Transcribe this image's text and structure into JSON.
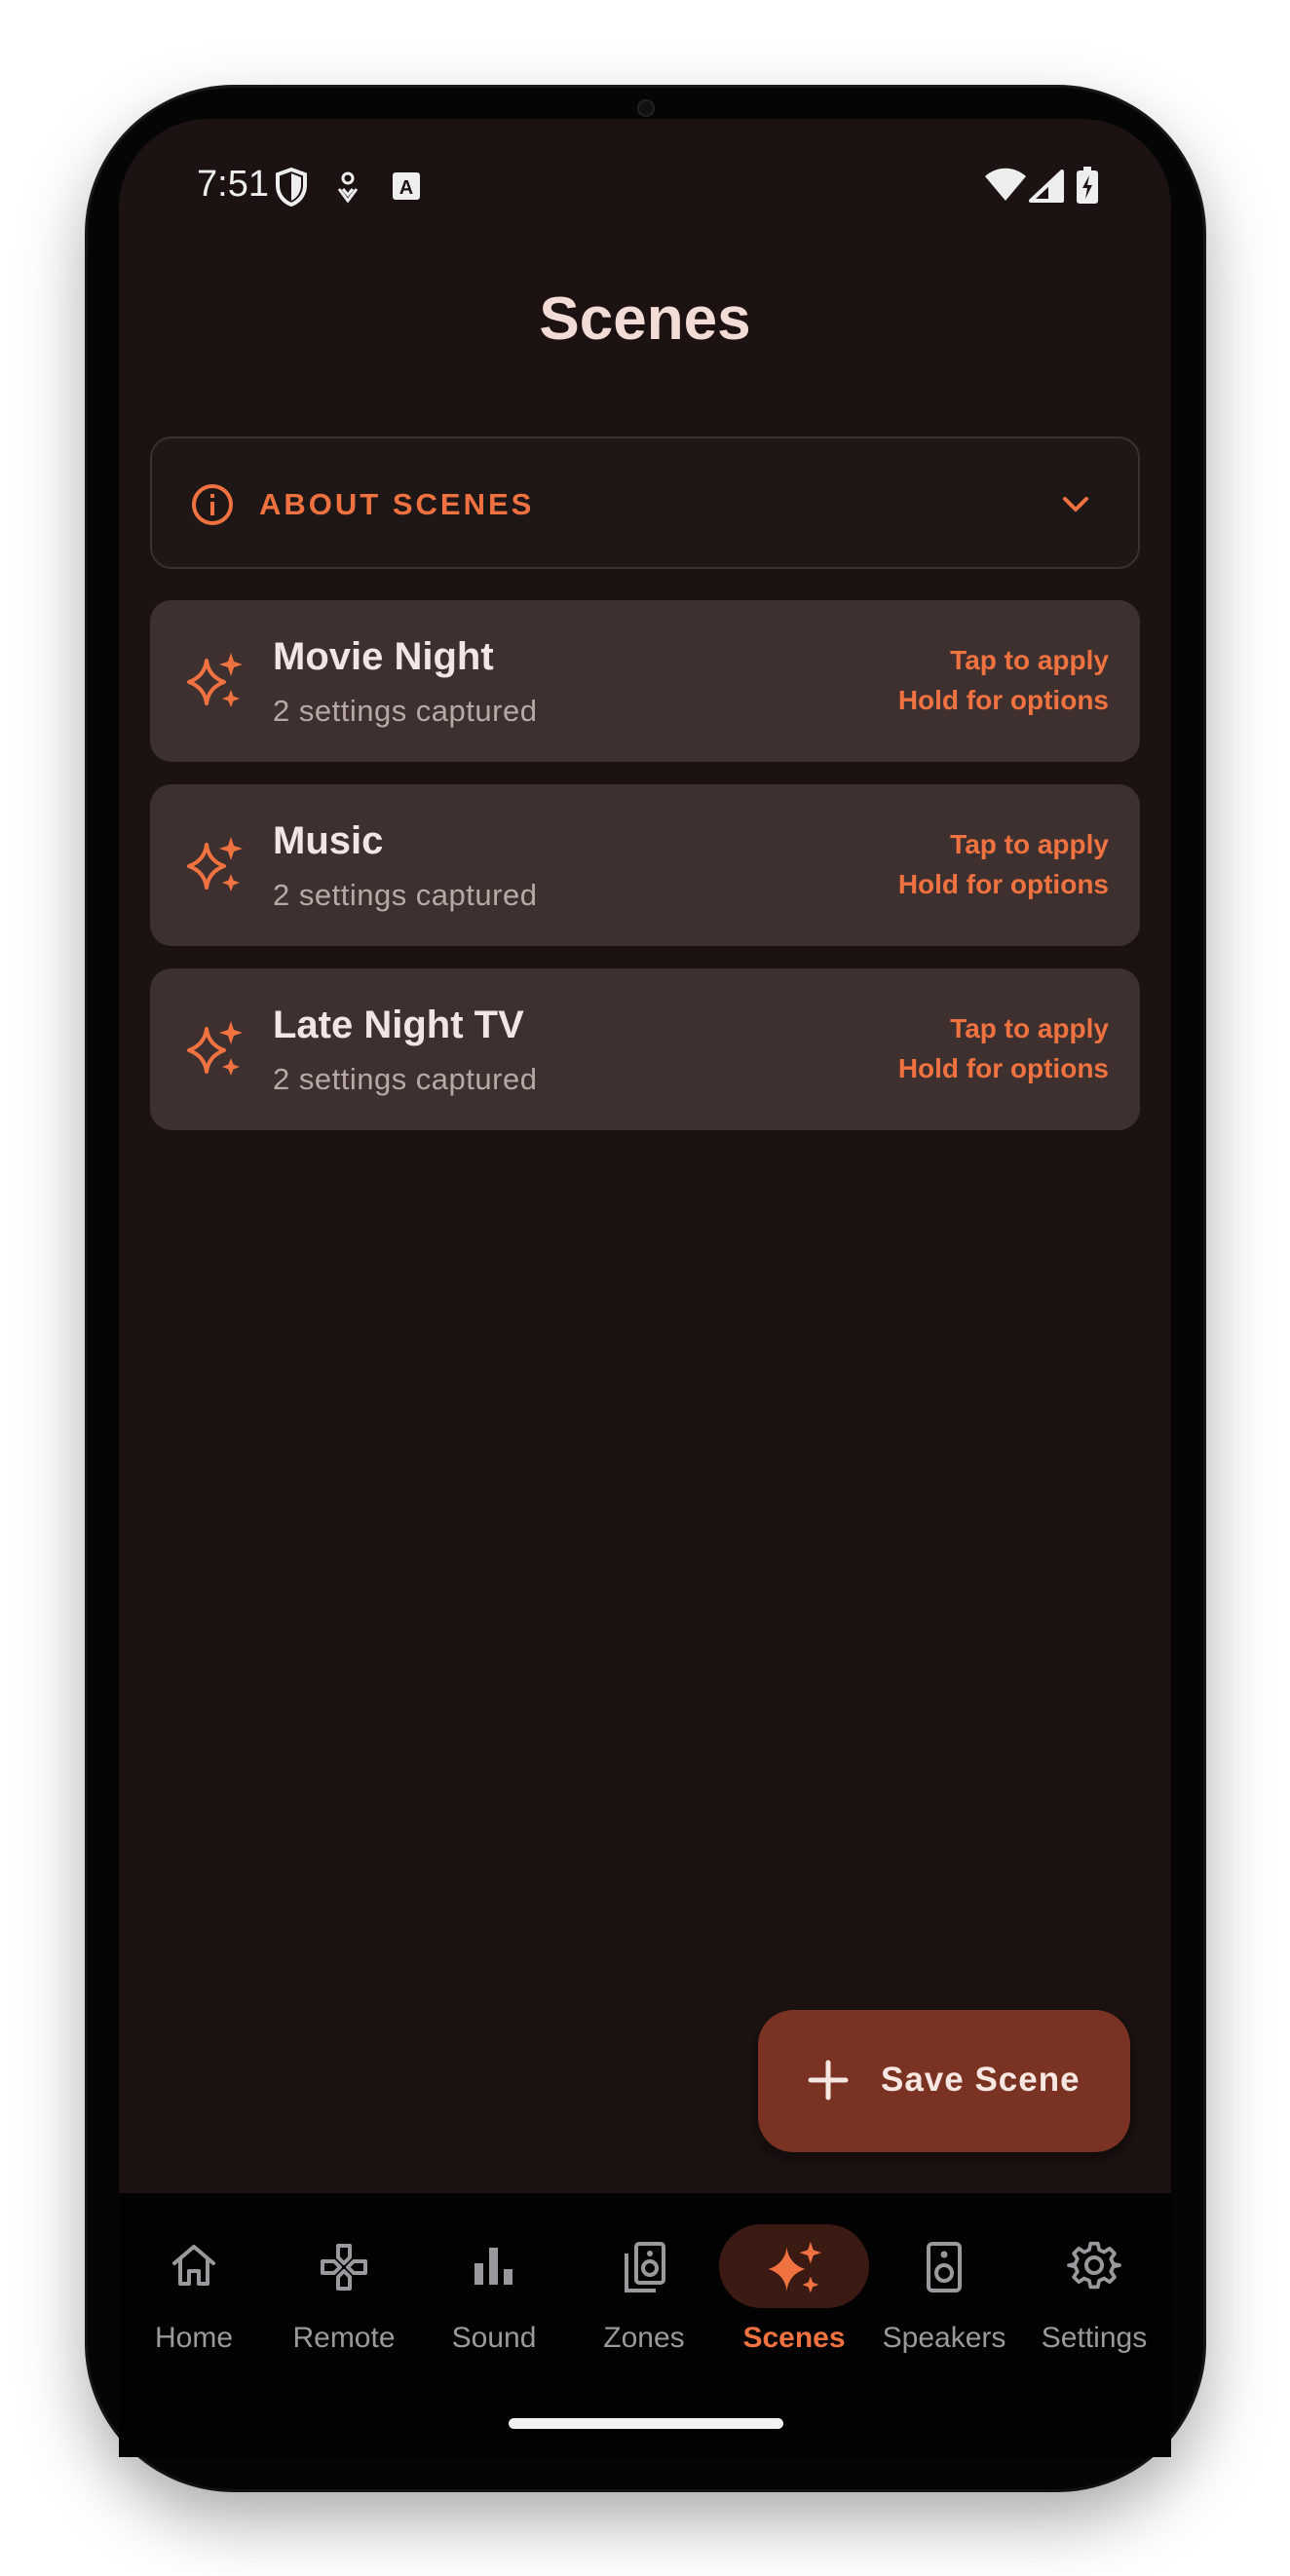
{
  "status_bar": {
    "time": "7:51",
    "left_icons": [
      "shield-icon",
      "gesture-icon",
      "keyboard-a-icon"
    ],
    "right_icons": [
      "wifi-icon",
      "signal-icon",
      "battery-charging-icon"
    ]
  },
  "page": {
    "title": "Scenes"
  },
  "about": {
    "label": "ABOUT SCENES",
    "icon": "info-icon",
    "expand_icon": "chevron-down-icon"
  },
  "scenes": [
    {
      "name": "Movie Night",
      "subtitle": "2 settings captured",
      "hint_tap": "Tap to apply",
      "hint_hold": "Hold for options"
    },
    {
      "name": "Music",
      "subtitle": "2 settings captured",
      "hint_tap": "Tap to apply",
      "hint_hold": "Hold for options"
    },
    {
      "name": "Late Night TV",
      "subtitle": "2 settings captured",
      "hint_tap": "Tap to apply",
      "hint_hold": "Hold for options"
    }
  ],
  "fab": {
    "label": "Save Scene",
    "icon": "plus-icon"
  },
  "nav": {
    "items": [
      {
        "label": "Home",
        "icon": "home-icon"
      },
      {
        "label": "Remote",
        "icon": "gamepad-icon"
      },
      {
        "label": "Sound",
        "icon": "bar-chart-icon"
      },
      {
        "label": "Zones",
        "icon": "speakers-group-icon"
      },
      {
        "label": "Scenes",
        "icon": "sparkle-icon"
      },
      {
        "label": "Speakers",
        "icon": "speaker-icon"
      },
      {
        "label": "Settings",
        "icon": "gear-icon"
      }
    ],
    "active": "Scenes"
  },
  "colors": {
    "accent": "#f07241",
    "background": "#1b1211",
    "card": "#3d302e",
    "fab": "#7a3322",
    "title": "#f3dcd6"
  }
}
